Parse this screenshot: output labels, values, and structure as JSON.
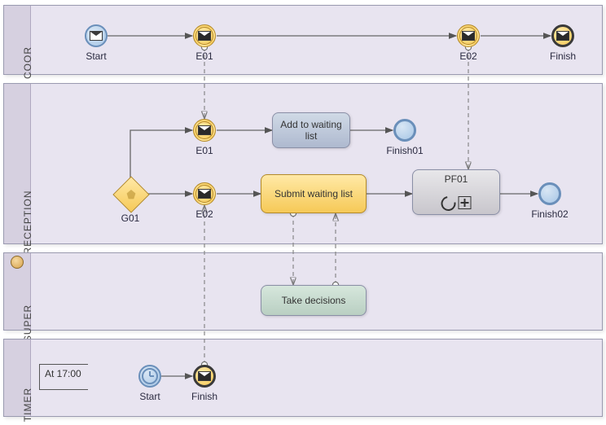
{
  "lanes": {
    "coor": {
      "title": "COOR"
    },
    "reception": {
      "title": "RECEPTION"
    },
    "super": {
      "title": "SUPER"
    },
    "timer": {
      "title": "TIMER"
    }
  },
  "coor": {
    "start": "Start",
    "e01": "E01",
    "e02": "E02",
    "finish": "Finish"
  },
  "reception": {
    "e01": "E01",
    "addTask": "Add to waiting list",
    "finish01": "Finish01",
    "g01": "G01",
    "e02": "E02",
    "submitTask": "Submit waiting list",
    "pf01": "PF01",
    "finish02": "Finish02"
  },
  "super": {
    "decide": "Take decisions"
  },
  "timer": {
    "annotation": "At 17:00",
    "start": "Start",
    "finish": "Finish"
  }
}
